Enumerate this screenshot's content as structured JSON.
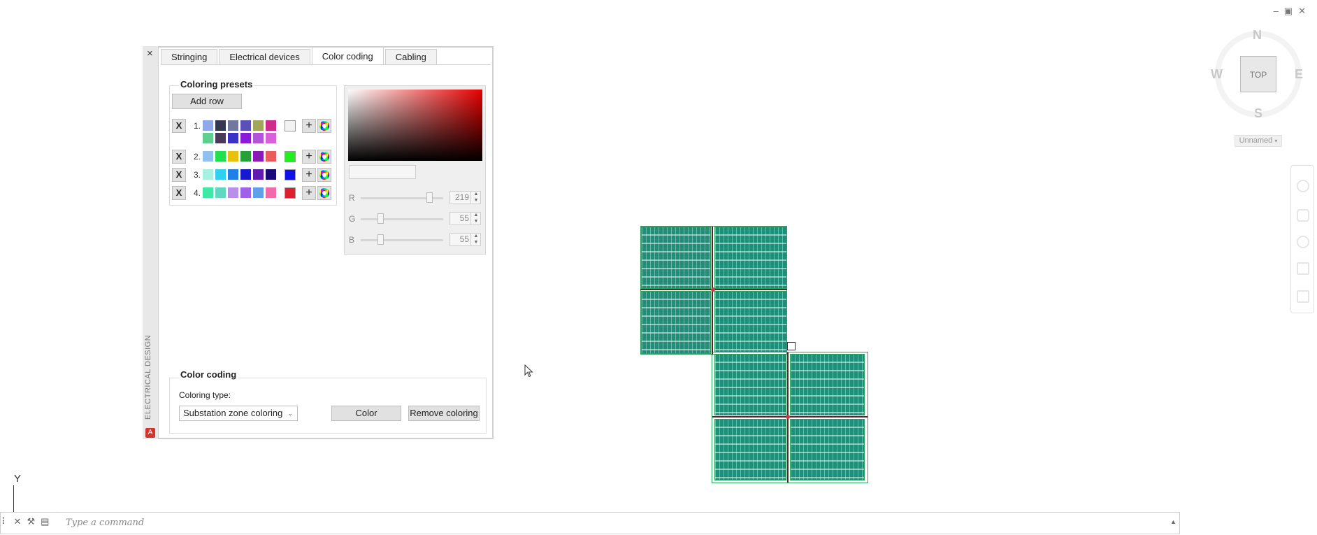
{
  "palette": {
    "title": "ELECTRICAL DESIGN",
    "close": "×",
    "logo": "A",
    "tabs": [
      {
        "label": "Stringing"
      },
      {
        "label": "Electrical devices"
      },
      {
        "label": "Color coding"
      },
      {
        "label": "Cabling"
      }
    ],
    "active_tab": "Color coding",
    "presets": {
      "title": "Coloring presets",
      "add_row": "Add row",
      "rows": [
        {
          "x": "X",
          "num": "1.",
          "colors": [
            "#8ea8e8",
            "#33374f",
            "#7078a0",
            "#5a50b8",
            "#9fa85a",
            "#d02a8a",
            "#5ecf8e",
            "#4a3a5a",
            "#3a32c8",
            "#8a1ad8",
            "#b255d8",
            "#d860d8"
          ],
          "indicator": "#f2f2f2"
        },
        {
          "x": "X",
          "num": "2.",
          "colors": [
            "#8ec0f0",
            "#20e050",
            "#e8c010",
            "#28a038",
            "#8a1ab8",
            "#e85c5c"
          ],
          "indicator": "#20f020"
        },
        {
          "x": "X",
          "num": "3.",
          "colors": [
            "#a8f0e0",
            "#30d0f0",
            "#2080e8",
            "#1818d0",
            "#601ab0",
            "#180878"
          ],
          "indicator": "#1010e8"
        },
        {
          "x": "X",
          "num": "4.",
          "colors": [
            "#40e8a8",
            "#60d8c0",
            "#b890e8",
            "#a060e8",
            "#60a0e8",
            "#f06aa8"
          ],
          "indicator": "#dc2030"
        }
      ],
      "plus": "+"
    },
    "picker": {
      "r_label": "R",
      "r_value": "219",
      "r_fraction": 0.86,
      "g_label": "G",
      "g_value": "55",
      "g_fraction": 0.216,
      "b_label": "B",
      "b_value": "55",
      "b_fraction": 0.216
    },
    "color_coding": {
      "title": "Color coding",
      "type_label": "Coloring type:",
      "type_value": "Substation zone coloring",
      "color_button": "Color",
      "remove_button": "Remove coloring"
    }
  },
  "viewcube": {
    "top": "TOP",
    "n": "N",
    "s": "S",
    "e": "E",
    "w": "W",
    "view_name": "Unnamed"
  },
  "axis": {
    "y": "Y"
  },
  "command": {
    "placeholder": "Type a command"
  },
  "colors": {
    "module_fill": "#1f8f7a",
    "block_outline": "#2aa15c",
    "zone_node": "#c43a4a"
  }
}
